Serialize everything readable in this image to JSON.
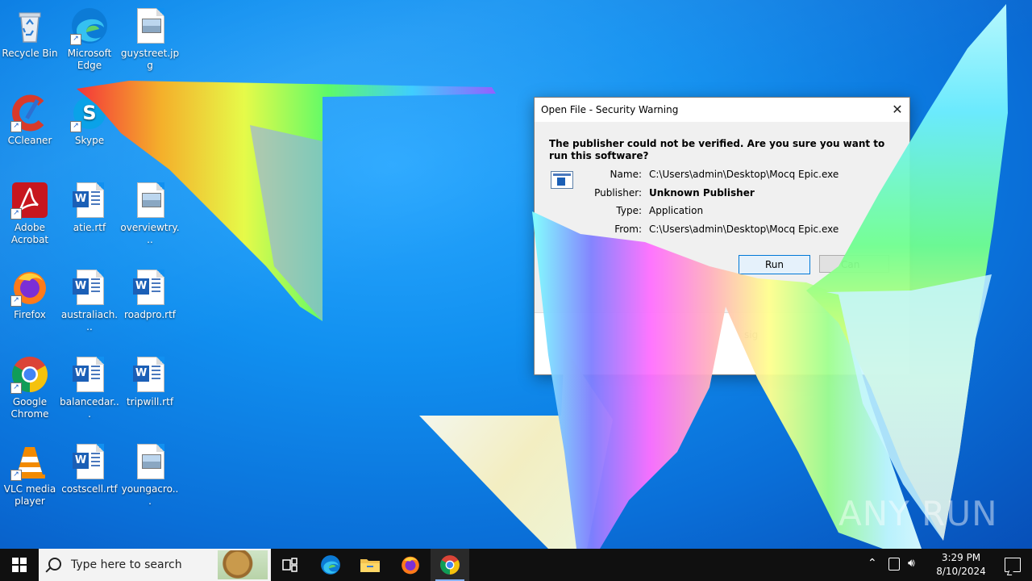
{
  "desktop_icons": [
    {
      "label": "Recycle Bin",
      "icon": "recycle-bin-icon"
    },
    {
      "label": "Microsoft Edge",
      "icon": "edge-icon"
    },
    {
      "label": "guystreet.jpg",
      "icon": "image-file-icon"
    },
    {
      "label": "CCleaner",
      "icon": "ccleaner-icon"
    },
    {
      "label": "Skype",
      "icon": "skype-icon"
    },
    {
      "label": "Adobe Acrobat",
      "icon": "acrobat-icon"
    },
    {
      "label": "atie.rtf",
      "icon": "word-document-icon"
    },
    {
      "label": "overviewtry...",
      "icon": "image-file-icon"
    },
    {
      "label": "Firefox",
      "icon": "firefox-icon"
    },
    {
      "label": "australiach...",
      "icon": "word-document-icon"
    },
    {
      "label": "roadpro.rtf",
      "icon": "word-document-icon"
    },
    {
      "label": "Google Chrome",
      "icon": "chrome-icon"
    },
    {
      "label": "balancedar...",
      "icon": "word-document-icon"
    },
    {
      "label": "tripwill.rtf",
      "icon": "word-document-icon"
    },
    {
      "label": "VLC media player",
      "icon": "vlc-icon"
    },
    {
      "label": "costscell.rtf",
      "icon": "word-document-icon"
    },
    {
      "label": "youngacro...",
      "icon": "image-file-icon"
    }
  ],
  "dialog": {
    "title": "Open File - Security Warning",
    "close_glyph": "✕",
    "question": "The publisher could not be verified.  Are you sure you want to run this software?",
    "fields": {
      "name_label": "Name:",
      "name_value": "C:\\Users\\admin\\Desktop\\Mocq Epic.exe",
      "publisher_label": "Publisher:",
      "publisher_value": "Unknown Publisher",
      "type_label": "Type:",
      "type_value": "Application",
      "from_label": "From:",
      "from_value": "C:\\Users\\admin\\Desktop\\Mocq Epic.exe"
    },
    "run_label": "Run",
    "cancel_label": "Can",
    "footer_text": "sig"
  },
  "taskbar": {
    "search_placeholder": "Type here to search",
    "time": "3:29 PM",
    "date": "8/10/2024"
  },
  "watermark": "ANY RUN",
  "colors": {
    "desktop_blue": "#1190f0",
    "taskbar": "#101010",
    "run_button_border": "#0078d7"
  }
}
